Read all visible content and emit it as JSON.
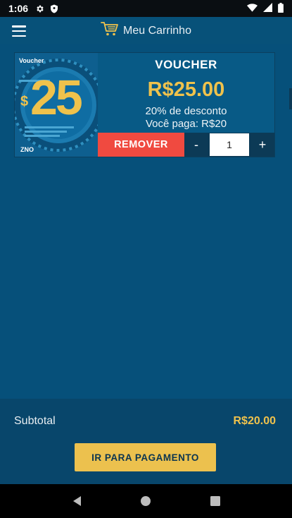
{
  "status_bar": {
    "time": "1:06"
  },
  "app_bar": {
    "title": "Meu Carrinho"
  },
  "cart": {
    "items": [
      {
        "thumbnail": {
          "badge_text": "Voucher",
          "amount": "25",
          "currency_symbol": "$",
          "footer_text": "ZNO"
        },
        "title": "VOUCHER",
        "price": "R$25.00",
        "discount": "20% de desconto",
        "you_pay": "Você paga: R$20",
        "remove_label": "REMOVER",
        "decrement_label": "-",
        "quantity": "1",
        "increment_label": "+"
      }
    ]
  },
  "summary": {
    "subtotal_label": "Subtotal",
    "subtotal_value": "R$20.00",
    "checkout_label": "IR PARA PAGAMENTO"
  },
  "colors": {
    "app_bar": "#075179",
    "background": "#06507a",
    "accent_gold": "#efc24c",
    "remove_red": "#f04a40",
    "checkout_button": "#ecc14e"
  }
}
